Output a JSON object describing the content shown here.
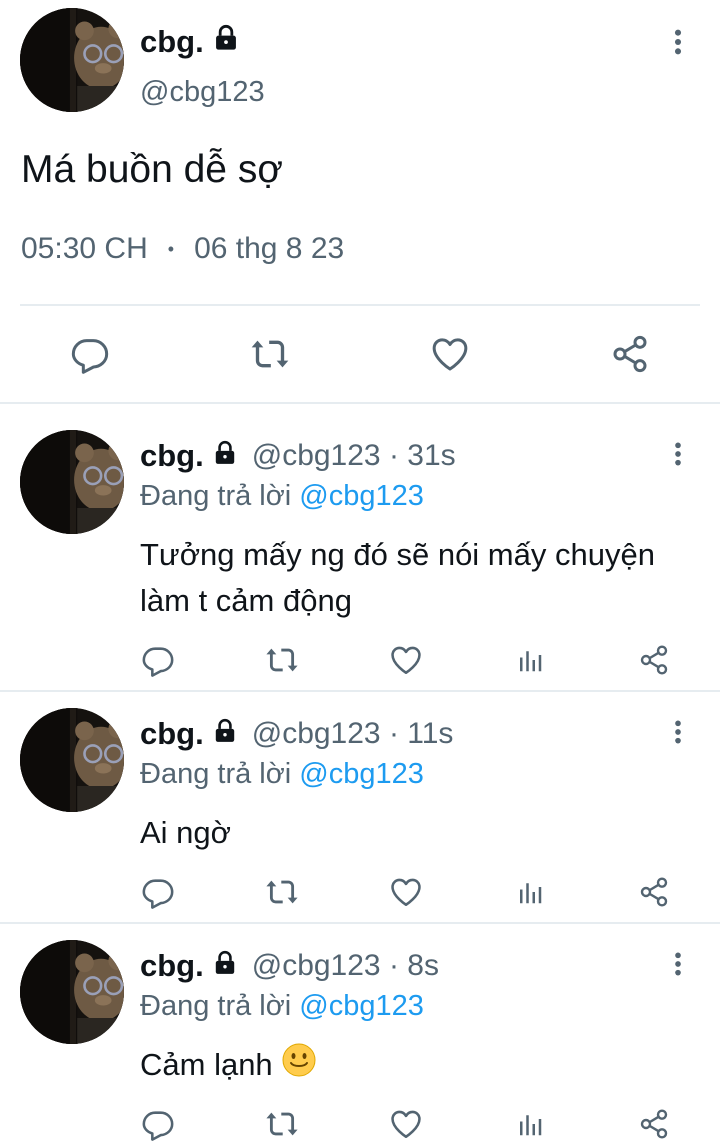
{
  "main": {
    "display_name": "cbg.",
    "handle": "@cbg123",
    "text": "Má buồn dễ sợ",
    "time": "05:30 CH",
    "date": "06 thg 8 23",
    "dot": "•"
  },
  "replies": [
    {
      "display_name": "cbg.",
      "handle_time": "@cbg123 · 31s",
      "replying_prefix": "Đang trả lời ",
      "replying_to": "@cbg123",
      "text": "Tưởng mấy ng đó sẽ nói mấy chuyện làm t cảm động"
    },
    {
      "display_name": "cbg.",
      "handle_time": "@cbg123 · 11s",
      "replying_prefix": "Đang trả lời ",
      "replying_to": "@cbg123",
      "text": "Ai ngờ"
    },
    {
      "display_name": "cbg.",
      "handle_time": "@cbg123 · 8s",
      "replying_prefix": "Đang trả lời ",
      "replying_to": "@cbg123",
      "text": "Cảm lạnh"
    }
  ],
  "icons": {
    "reply": "reply-icon",
    "retweet": "retweet-icon",
    "like": "like-icon",
    "analytics": "analytics-icon",
    "share": "share-icon",
    "lock": "lock-icon",
    "more": "more-icon",
    "emoji": "slightly-smiling-face-icon"
  },
  "colors": {
    "text": "#0f1419",
    "secondary": "#536471",
    "link": "#1d9bf0",
    "divider": "#e6ecf0"
  }
}
